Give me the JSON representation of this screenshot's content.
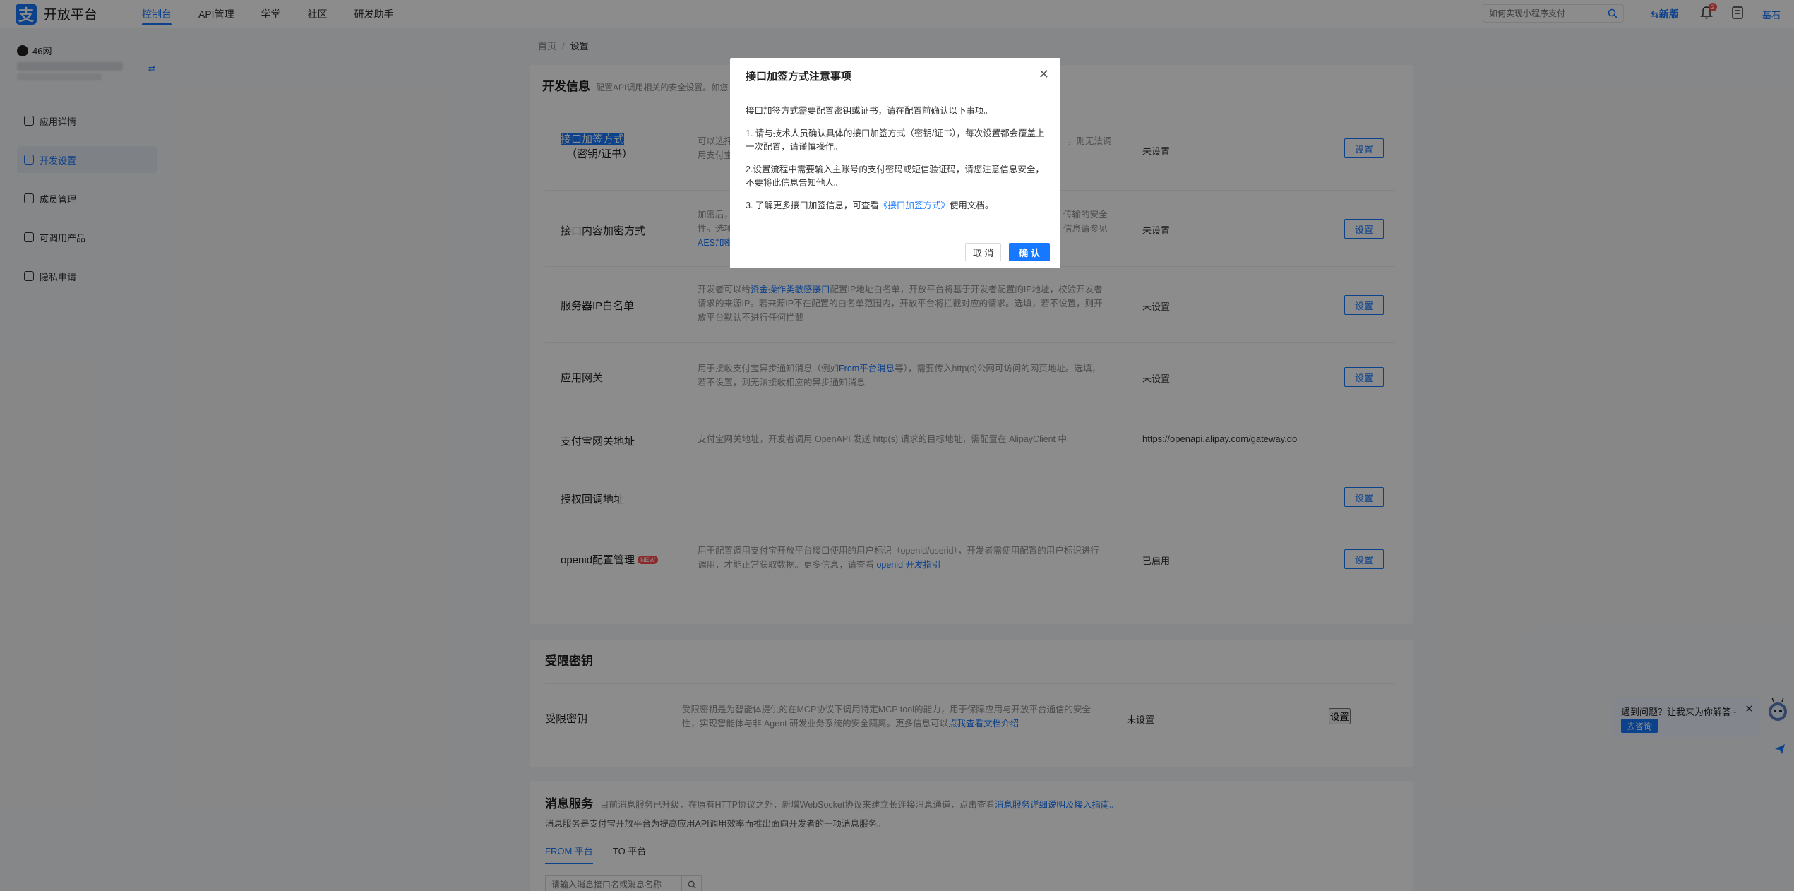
{
  "header": {
    "logo_glyph": "支",
    "logo_text": "开放平台",
    "nav": [
      "控制台",
      "API管理",
      "学堂",
      "社区",
      "研发助手"
    ],
    "search_placeholder": "如何实现小程序支付",
    "new_version": "新版",
    "notification_count": "2",
    "user_name": "基石"
  },
  "sidebar": {
    "app_name": "46网",
    "menu": [
      "应用详情",
      "开发设置",
      "成员管理",
      "可调用产品",
      "隐私申请"
    ]
  },
  "breadcrumb": {
    "home": "首页",
    "sep": "/",
    "current": "设置"
  },
  "dev_info": {
    "title": "开发信息",
    "desc": "配置API调用相关的安全设置。如您",
    "rows": [
      {
        "label_line1": "接口加签方式",
        "label_line2": "（密钥/证书）",
        "desc": "可以选择",
        "desc2": "用支付宝",
        "desc_right": "，则无法调",
        "status": "未设置",
        "button": "设置"
      },
      {
        "label": "接口内容加密方式",
        "desc": "加密后，",
        "desc_right": "传输的安全",
        "desc2": "性。选项",
        "desc2_right": "信息请参见",
        "desc3": "AES加密",
        "status": "未设置",
        "button": "设置"
      },
      {
        "label": "服务器IP白名单",
        "desc_pre": "开发者可以给",
        "desc_link": "资金操作类敏感接口",
        "desc_post": "配置IP地址白名单，开放平台将基于开发者配置的IP地址，校验开发者请求的来源IP。若来源IP不在配置的白名单范围内，开放平台将拦截对应的请求。选填，若不设置，则开放平台默认不进行任何拦截",
        "status": "未设置",
        "button": "设置"
      },
      {
        "label": "应用网关",
        "desc_pre": "用于接收支付宝异步通知消息（例如",
        "desc_link": "From平台消息",
        "desc_post": "等），需要传入http(s)公网可访问的网页地址。选填，若不设置，则无法接收相应的异步通知消息",
        "status": "未设置",
        "button": "设置"
      },
      {
        "label": "支付宝网关地址",
        "desc": "支付宝网关地址，开发者调用 OpenAPI 发送 http(s) 请求的目标地址，需配置在 AlipayClient 中",
        "status": "https://openapi.alipay.com/gateway.do"
      },
      {
        "label": "授权回调地址",
        "button": "设置"
      },
      {
        "label": "openid配置管理",
        "tag": "NEW",
        "desc_pre": "用于配置调用支付宝开放平台接口使用的用户标识（openid/userid），开发者需使用配置的用户标识进行调用，才能正常获取数据。更多信息，请查看 ",
        "desc_link": "openid 开发指引",
        "status": "已启用",
        "button": "设置"
      }
    ]
  },
  "restricted": {
    "title": "受限密钥",
    "row_label": "受限密钥",
    "desc_pre": "受限密钥是为智能体提供的在MCP协议下调用特定MCP tool的能力，用于保障应用与开放平台通信的安全性，实现智能体与非 Agent 研发业务系统的安全隔离。更多信息可以",
    "desc_link": "点我查看文档介绍",
    "status": "未设置",
    "button": "设置"
  },
  "message_service": {
    "title": "消息服务",
    "desc_pre": "目前消息服务已升级，在原有HTTP协议之外，新增WebSocket协议来建立长连接消息通道，点击查看",
    "desc_link": "消息服务详细说明及接入指南。",
    "desc2": "消息服务是支付宝开放平台为提高应用API调用效率而推出面向开发者的一项消息服务。",
    "tabs": [
      "FROM 平台",
      "TO 平台"
    ],
    "search_placeholder": "请输入消息接口名或消息名称"
  },
  "help_widget": {
    "text": "遇到问题？让我来为你解答~",
    "button": "去咨询"
  },
  "modal": {
    "title": "接口加签方式注意事项",
    "intro": "接口加签方式需要配置密钥或证书，请在配置前确认以下事项。",
    "item1": "1. 请与技术人员确认具体的接口加签方式（密钥/证书），每次设置都会覆盖上一次配置，请谨慎操作。",
    "item2": "2.设置流程中需要输入主账号的支付密码或短信验证码，请您注意信息安全，不要将此信息告知他人。",
    "item3_pre": "3. 了解更多接口加签信息，可查看",
    "item3_link": "《接口加签方式》",
    "item3_post": "使用文档。",
    "cancel": "取 消",
    "ok": "确 认"
  }
}
